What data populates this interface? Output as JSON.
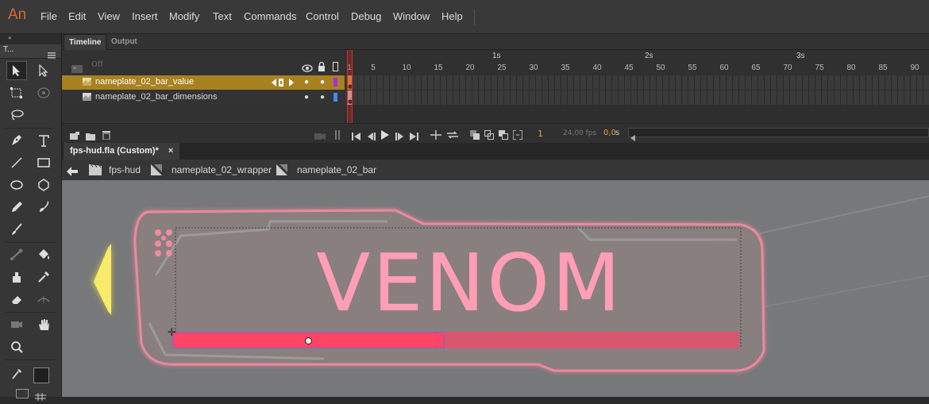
{
  "app": {
    "logo": "An"
  },
  "menu": [
    "File",
    "Edit",
    "View",
    "Insert",
    "Modify",
    "Text",
    "Commands",
    "Control",
    "Debug",
    "Window",
    "Help"
  ],
  "toolbar": {
    "collapse_glyph": "«",
    "tab_label": "T..."
  },
  "timeline": {
    "tabs": {
      "timeline": "Timeline",
      "output": "Output"
    },
    "header_off_label": "Off",
    "layers": [
      {
        "name": "nameplate_02_bar_value",
        "color": "#a82de0",
        "selected": true
      },
      {
        "name": "nameplate_02_bar_dimensions",
        "color": "#3f8ef0",
        "selected": false
      }
    ],
    "ruler_seconds": {
      "s1": "1s",
      "s2": "2s",
      "s3": "3s"
    },
    "ruler_numbers": {
      "f1": "1",
      "f5": "5",
      "f10": "10",
      "f15": "15",
      "f20": "20",
      "f25": "25",
      "f30": "30",
      "f35": "35",
      "f40": "40",
      "f45": "45",
      "f50": "50",
      "f55": "55",
      "f60": "60",
      "f65": "65",
      "f70": "70",
      "f75": "75",
      "f80": "80",
      "f85": "85",
      "f90": "90"
    },
    "current_frame": "1",
    "fps": "24,00 fps",
    "elapsed": "0,0",
    "elapsed_unit": "s"
  },
  "document": {
    "tab_title": "fps-hud.fla (Custom)*",
    "close_glyph": "×"
  },
  "breadcrumb": {
    "scene": "fps-hud",
    "symbol1": "nameplate_02_wrapper",
    "symbol2": "nameplate_02_bar"
  },
  "stage": {
    "title_text": "VENOM",
    "bar_fill_fraction": 0.48
  },
  "colors": {
    "accent_text": "#ff9eb4",
    "bar_fill": "#ff4466",
    "bar_bg": "#d9566f",
    "layer_highlight": "#a88121"
  }
}
